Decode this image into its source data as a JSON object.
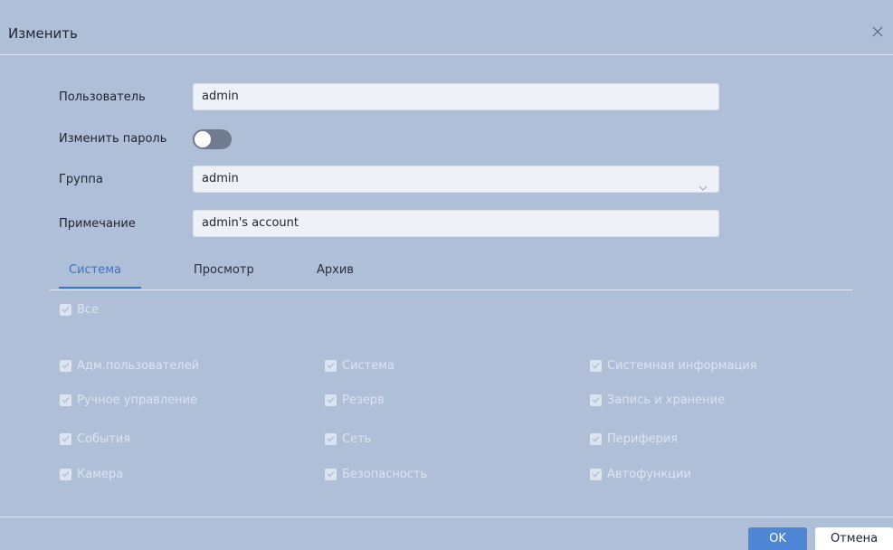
{
  "dialog": {
    "title": "Изменить",
    "close_icon": "close-icon"
  },
  "form": {
    "user_label": "Пользователь",
    "user_value": "admin",
    "change_password_label": "Изменить пароль",
    "change_password_on": false,
    "group_label": "Группа",
    "group_value": "admin",
    "note_label": "Примечание",
    "note_value": "admin's account"
  },
  "tabs": [
    {
      "label": "Система",
      "active": true
    },
    {
      "label": "Просмотр",
      "active": false
    },
    {
      "label": "Архив",
      "active": false
    }
  ],
  "permissions": {
    "all_label": "Все",
    "items": [
      "Адм.пользователей",
      "Система",
      "Системная информация",
      "Ручное управление",
      "Резерв",
      "Запись и хранение",
      "События",
      "Сеть",
      "Периферия",
      "Камера",
      "Безопасность",
      "Автофункции"
    ]
  },
  "footer": {
    "ok_label": "OK",
    "cancel_label": "Отмена"
  },
  "colors": {
    "background": "#b0bfd8",
    "accent": "#3a74c4",
    "ok_button": "#4f86d5"
  }
}
